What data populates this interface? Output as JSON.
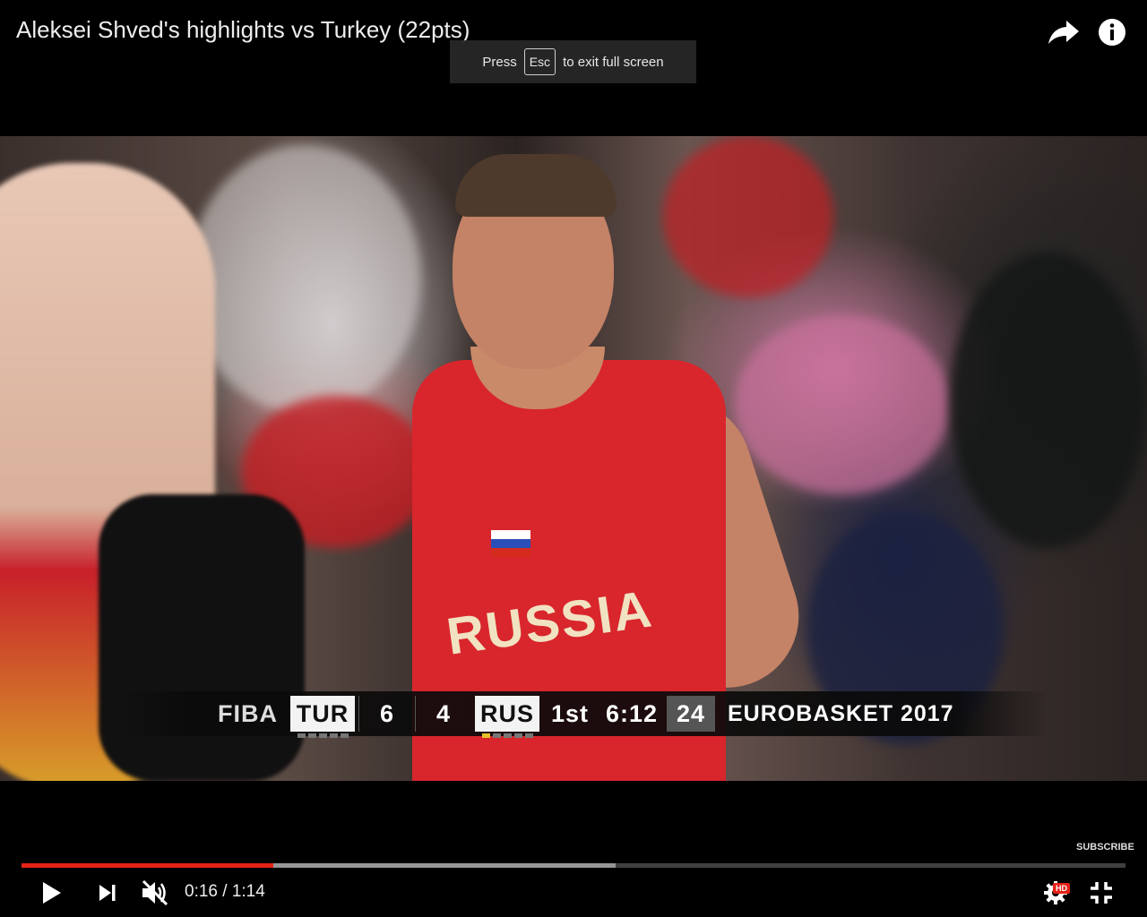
{
  "video": {
    "title": "Aleksei Shved's highlights vs Turkey (22pts)"
  },
  "fullscreen_toast": {
    "press": "Press",
    "key": "Esc",
    "message": "to exit full screen"
  },
  "scoreboard": {
    "league": "FIBA",
    "team_home": "TUR",
    "score_home": "6",
    "score_away": "4",
    "team_away": "RUS",
    "period": "1st",
    "clock": "6:12",
    "shot_clock": "24",
    "event": "EUROBASKET 2017"
  },
  "jersey": {
    "text": "RUSSIA"
  },
  "player": {
    "subscribe_label": "SUBSCRIBE",
    "current_time": "0:16",
    "separator": " / ",
    "duration": "1:14",
    "progress_played_fraction": 0.228,
    "progress_buffered_fraction": 0.538,
    "hd_badge": "HD",
    "icons": {
      "share": "share-icon",
      "info": "info-icon",
      "play": "play-icon",
      "next": "next-icon",
      "mute": "volume-muted-icon",
      "settings": "gear-icon",
      "exit_fullscreen": "exit-fullscreen-icon"
    }
  },
  "colors": {
    "progress_played": "#e62117",
    "hd_badge": "#e62117"
  }
}
